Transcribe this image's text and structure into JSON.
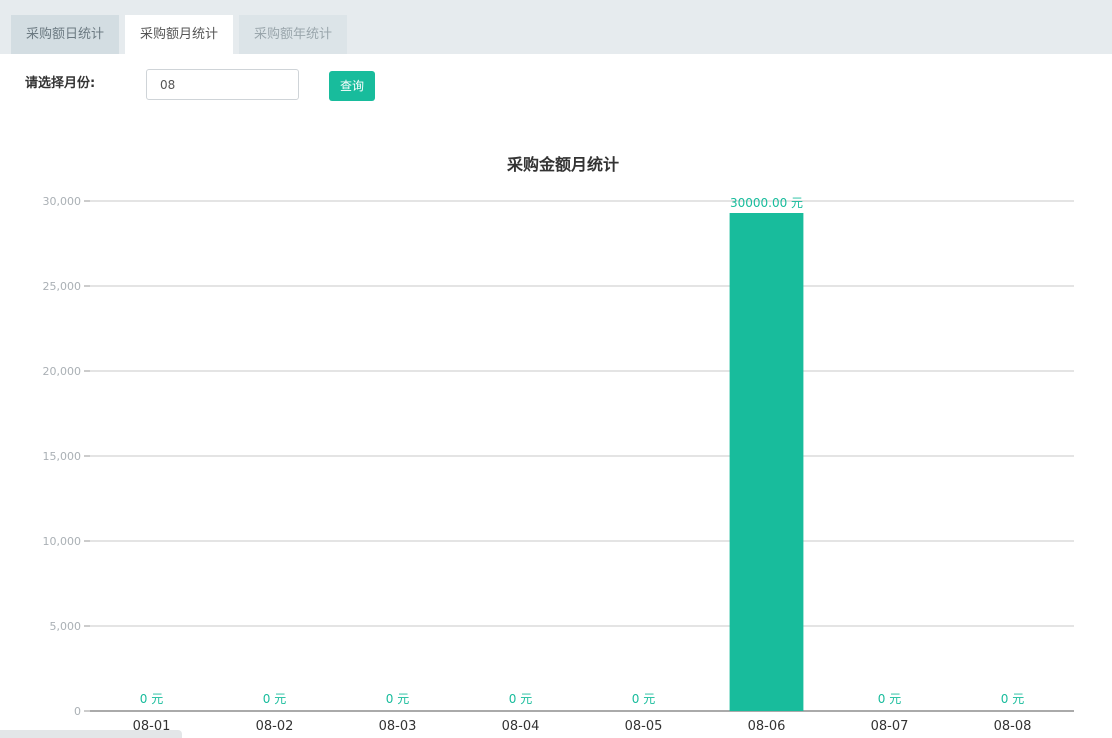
{
  "tabs": [
    {
      "label": "采购额日统计",
      "active": false
    },
    {
      "label": "采购额月统计",
      "active": true
    },
    {
      "label": "采购额年统计",
      "active": false
    }
  ],
  "filter": {
    "label": "请选择月份:",
    "month_value": "08",
    "query_label": "查询"
  },
  "colors": {
    "accent": "#18bc9c",
    "tab_bg": "#e6ebee",
    "grid": "#c8c8c8"
  },
  "chart_data": {
    "type": "bar",
    "title": "采购金额月统计",
    "categories": [
      "08-01",
      "08-02",
      "08-03",
      "08-04",
      "08-05",
      "08-06",
      "08-07",
      "08-08"
    ],
    "values": [
      0,
      0,
      0,
      0,
      0,
      30000,
      0,
      0
    ],
    "value_labels": [
      "0 元",
      "0 元",
      "0 元",
      "0 元",
      "0 元",
      "30000.00 元",
      "0 元",
      "0 元"
    ],
    "y_ticks": [
      0,
      5000,
      10000,
      15000,
      20000,
      25000,
      30000
    ],
    "y_tick_labels": [
      "0",
      "5,000",
      "10,000",
      "15,000",
      "20,000",
      "25,000",
      "30,000"
    ],
    "ylim": [
      0,
      30000
    ],
    "xlabel": "",
    "ylabel": "",
    "grid": true,
    "bar_color": "#18bc9c"
  }
}
